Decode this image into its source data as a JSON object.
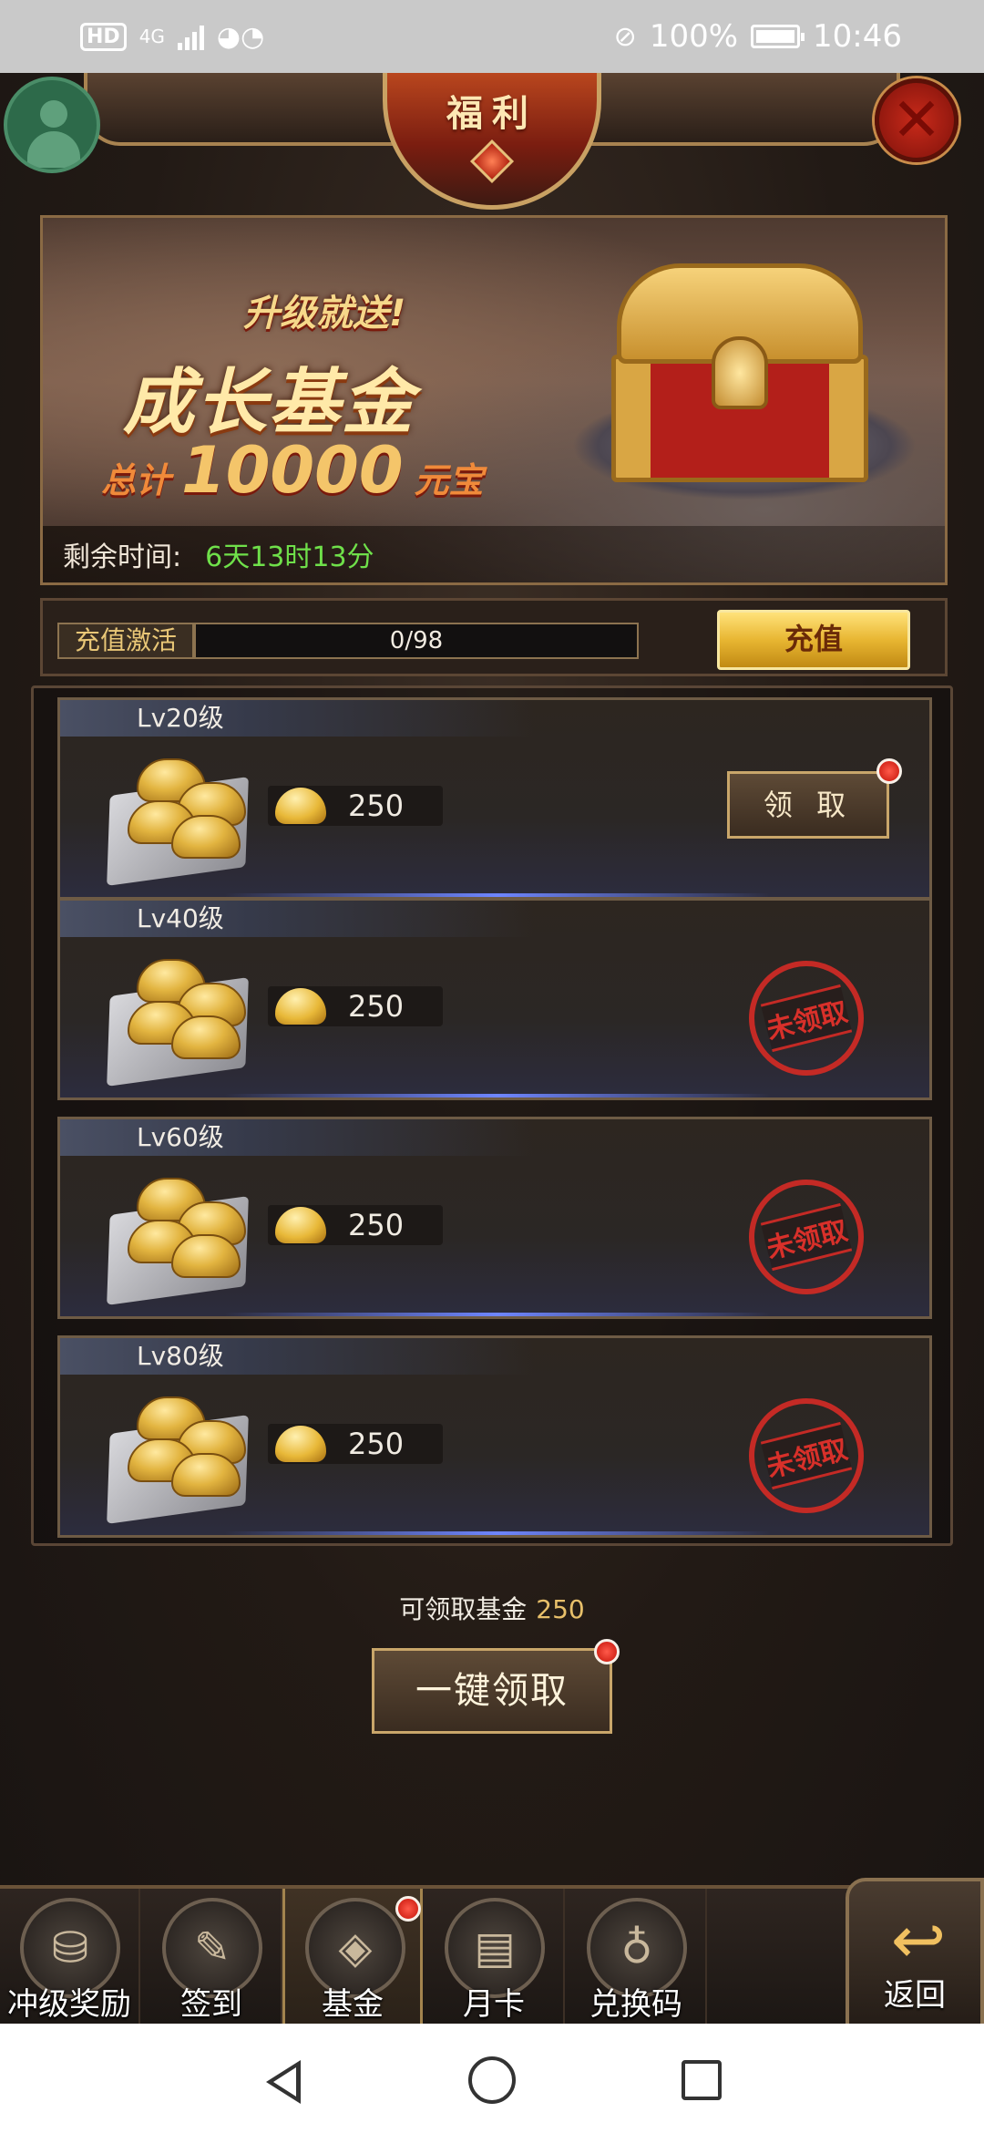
{
  "status_bar": {
    "hd": "HD",
    "network": "4G",
    "battery_pct": "100%",
    "time": "10:46",
    "icons": [
      "hd-icon",
      "signal-icon",
      "wechat-icon",
      "mute-icon",
      "battery-icon"
    ]
  },
  "header": {
    "title": "福利",
    "close_icon": "close-icon"
  },
  "banner": {
    "tagline": "升级就送!",
    "headline": "成长基金",
    "total_prefix": "总计",
    "total_amount": "10000",
    "total_unit": "元宝",
    "remaining_label": "剩余时间:",
    "remaining_value": "6天13时13分"
  },
  "recharge": {
    "label": "充值激活",
    "progress_text": "0/98",
    "progress": {
      "current": 0,
      "target": 98
    },
    "button": "充值"
  },
  "rewards": [
    {
      "level": "Lv20级",
      "amount": "250",
      "status": "claimable",
      "action": "领 取",
      "badge": true
    },
    {
      "level": "Lv40级",
      "amount": "250",
      "status": "unclaimed",
      "stamp": "未领取"
    },
    {
      "level": "Lv60级",
      "amount": "250",
      "status": "unclaimed",
      "stamp": "未领取"
    },
    {
      "level": "Lv80级",
      "amount": "250",
      "status": "unclaimed",
      "stamp": "未领取"
    }
  ],
  "footer": {
    "claimable_label": "可领取基金",
    "claimable_value": "250",
    "one_click_button": "一键领取"
  },
  "tabs": [
    {
      "label": "冲级奖励",
      "icon": "treasure-bowl-icon",
      "active": false
    },
    {
      "label": "签到",
      "icon": "brush-sign-icon",
      "active": false
    },
    {
      "label": "基金",
      "icon": "coin-icon",
      "active": true,
      "badge": true
    },
    {
      "label": "月卡",
      "icon": "card-icon",
      "active": false
    },
    {
      "label": "兑换码",
      "icon": "money-bag-icon",
      "active": false
    }
  ],
  "back_button": {
    "label": "返回",
    "icon": "return-arrow-icon"
  },
  "colors": {
    "accent_gold": "#e8b632",
    "timer_green": "#6fe04a",
    "stamp_red": "#c42a25",
    "notify_red": "#ff3b2a"
  }
}
